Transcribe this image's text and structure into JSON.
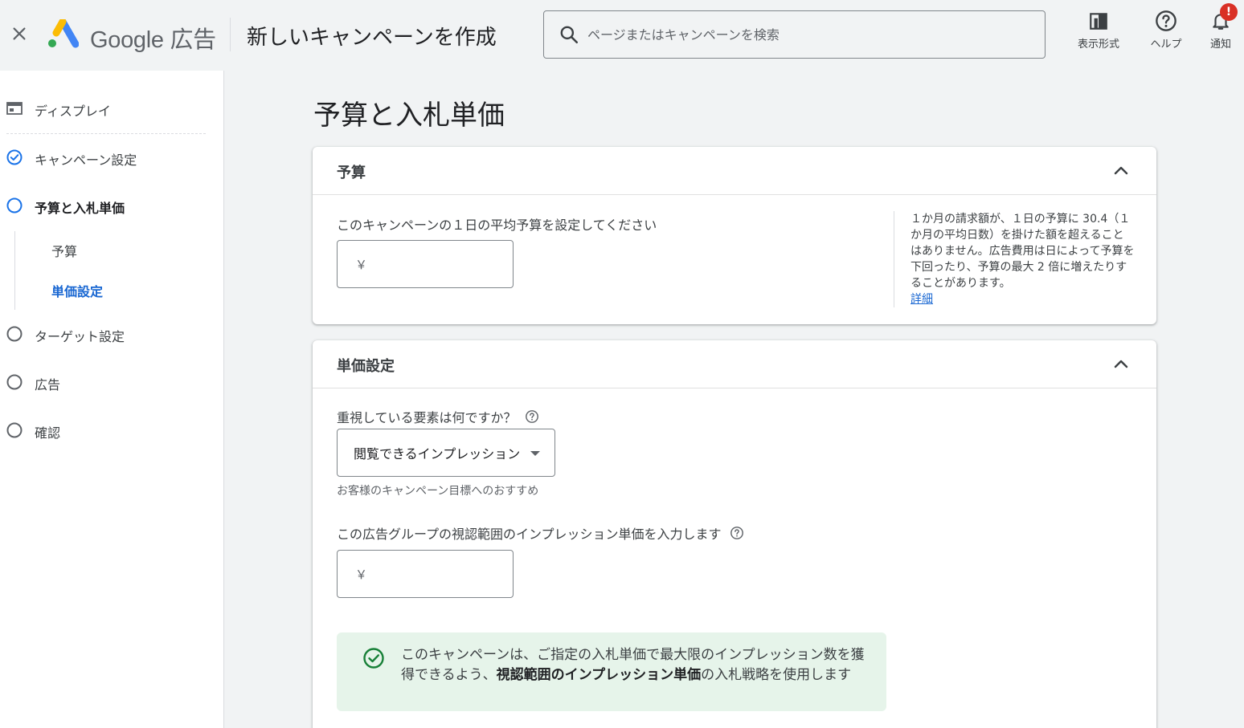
{
  "header": {
    "brand_google": "Google",
    "brand_ads": "広告",
    "title": "新しいキャンペーンを作成",
    "search_placeholder": "ページまたはキャンペーンを検索",
    "actions": [
      {
        "label": "表示形式",
        "icon": "view-format-icon"
      },
      {
        "label": "ヘルプ",
        "icon": "help-icon"
      },
      {
        "label": "通知",
        "icon": "bell-icon",
        "badge": "!"
      }
    ]
  },
  "sidebar": {
    "items": [
      {
        "label": "ディスプレイ",
        "icon": "display-icon",
        "state": "type"
      },
      {
        "label": "キャンペーン設定",
        "icon": "check-circle-icon",
        "state": "done"
      },
      {
        "label": "予算と入札単価",
        "icon": "circle-icon",
        "state": "active"
      },
      {
        "label": "ターゲット設定",
        "icon": "circle-icon",
        "state": "todo"
      },
      {
        "label": "広告",
        "icon": "circle-icon",
        "state": "todo"
      },
      {
        "label": "確認",
        "icon": "circle-icon",
        "state": "todo"
      }
    ],
    "subitems": [
      {
        "label": "予算",
        "current": false
      },
      {
        "label": "単価設定",
        "current": true
      }
    ]
  },
  "main": {
    "title": "予算と入札単価",
    "budget_card": {
      "title": "予算",
      "field_label": "このキャンペーンの１日の平均予算を設定してください",
      "currency_symbol": "￥",
      "value": "",
      "note": "１か月の請求額が、１日の予算に 30.4（１か月の平均日数）を掛けた額を超えることはありません。広告費用は日によって予算を下回ったり、予算の最大 2 倍に増えたりすることがあります。",
      "note_link": "詳細"
    },
    "bidding_card": {
      "title": "単価設定",
      "focus_label": "重視している要素は何ですか？",
      "focus_value": "閲覧できるインプレッション",
      "focus_hint": "お客様のキャンペーン目標へのおすすめ",
      "bid_label": "この広告グループの視認範囲のインプレッション単価を入力します",
      "currency_symbol": "￥",
      "bid_value": "",
      "info_prefix": "このキャンペーンは、ご指定の入札単価で最大限のインプレッション数を獲得できるよう、",
      "info_bold": "視認範囲のインプレッション単価",
      "info_suffix": "の入札戦略を使用します"
    }
  },
  "colors": {
    "accent_blue": "#1a73e8",
    "success_green": "#188038",
    "alert_red": "#d93025",
    "info_bg": "#e6f4ea"
  }
}
